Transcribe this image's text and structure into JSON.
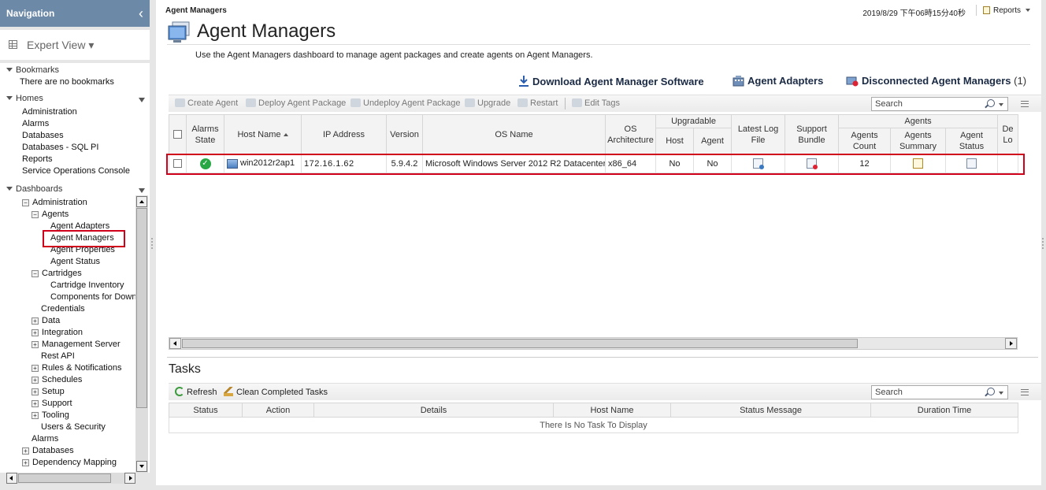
{
  "nav": {
    "title": "Navigation",
    "collapse_glyph": "‹",
    "view_label": "Expert View ▾",
    "bookmarks_label": "Bookmarks",
    "bookmarks_empty": "There are no bookmarks",
    "homes_label": "Homes",
    "homes": [
      "Administration",
      "Alarms",
      "Databases",
      "Databases - SQL PI",
      "Reports",
      "Service Operations Console"
    ],
    "dashboards_label": "Dashboards",
    "tree": {
      "administration": "Administration",
      "agents": "Agents",
      "agent_adapters": "Agent Adapters",
      "agent_managers": "Agent Managers",
      "agent_properties": "Agent Properties",
      "agent_status": "Agent Status",
      "cartridges": "Cartridges",
      "cartridge_inventory": "Cartridge Inventory",
      "components_for_down": "Components for Down",
      "credentials": "Credentials",
      "data": "Data",
      "integration": "Integration",
      "management_server": "Management Server",
      "rest_api": "Rest API",
      "rules_notifications": "Rules & Notifications",
      "schedules": "Schedules",
      "setup": "Setup",
      "support": "Support",
      "tooling": "Tooling",
      "users_security": "Users & Security",
      "alarms": "Alarms",
      "databases": "Databases",
      "dependency_mapping": "Dependency Mapping"
    },
    "plus": "+",
    "minus": "−"
  },
  "header": {
    "breadcrumb": "Agent Managers",
    "timestamp": "2019/8/29 下午06時15分40秒",
    "reports_label": "Reports",
    "page_title": "Agent Managers",
    "description": "Use the Agent Managers dashboard to manage agent packages and create agents on Agent Managers."
  },
  "actions": {
    "download": "Download Agent Manager Software",
    "adapters": "Agent Adapters",
    "disconnected": "Disconnected Agent Managers",
    "disconnected_count": "(1)"
  },
  "toolbar": {
    "create_agent": "Create Agent",
    "deploy_package": "Deploy Agent Package",
    "undeploy_package": "Undeploy Agent Package",
    "upgrade": "Upgrade",
    "restart": "Restart",
    "edit_tags": "Edit Tags",
    "search_placeholder": "Search"
  },
  "grid": {
    "headers": {
      "alarms_state": "Alarms State",
      "host_name": "Host Name",
      "ip_address": "IP Address",
      "version": "Version",
      "os_name": "OS Name",
      "os_arch": "OS Architecture",
      "upgradable": "Upgradable",
      "up_host": "Host",
      "up_agent": "Agent",
      "latest_log": "Latest Log File",
      "support_bundle": "Support Bundle",
      "agents": "Agents",
      "agents_count": "Agents Count",
      "agents_summary": "Agents Summary",
      "agent_status": "Agent Status",
      "de_lo": "De Lo"
    },
    "row": {
      "alarm_glyph": "✓",
      "host": "win2012r2ap1",
      "ip": "172.16.1.62",
      "version": "5.9.4.2",
      "os_name": "Microsoft Windows Server 2012 R2 Datacenter",
      "os_arch": "x86_64",
      "up_host": "No",
      "up_agent": "No",
      "agents_count": "12"
    }
  },
  "tasks": {
    "title": "Tasks",
    "refresh": "Refresh",
    "clean": "Clean Completed Tasks",
    "search_placeholder": "Search",
    "headers": [
      "Status",
      "Action",
      "Details",
      "Host Name",
      "Status Message",
      "Duration Time"
    ],
    "empty": "There Is No Task To Display"
  },
  "colors": {
    "nav_header": "#6d89a8",
    "highlight": "#d0021b",
    "ok_green": "#28a745"
  }
}
